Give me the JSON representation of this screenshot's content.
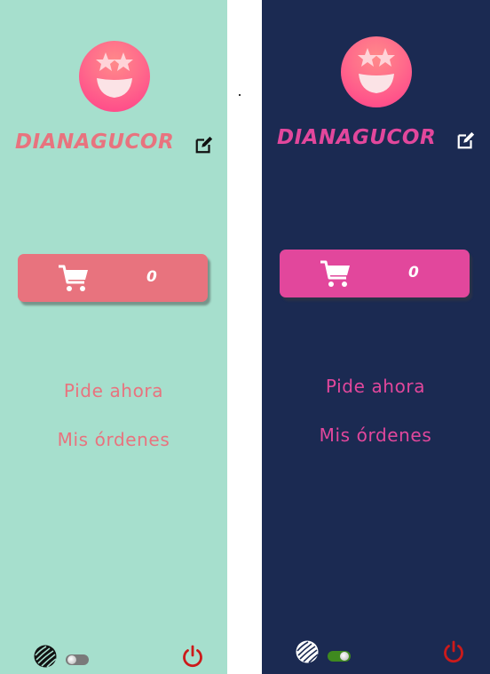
{
  "light_panel": {
    "username": "DIANAGUCOR",
    "cart_count": "0",
    "nav": {
      "order_now": "Pide ahora",
      "my_orders": "Mis órdenes"
    },
    "theme_toggle": {
      "state": "off"
    },
    "icons": {
      "avatar": "star-struck-face-icon",
      "edit": "edit-icon",
      "cart": "cart-icon",
      "theme": "theme-pattern-icon",
      "power": "power-icon"
    },
    "colors": {
      "background": "#a6dfcd",
      "accent": "#e8737e",
      "link": "#e8737e",
      "power": "#cc1a1a"
    }
  },
  "dark_panel": {
    "username": "DIANAGUCOR",
    "cart_count": "0",
    "nav": {
      "order_now": "Pide ahora",
      "my_orders": "Mis órdenes"
    },
    "theme_toggle": {
      "state": "on"
    },
    "icons": {
      "avatar": "star-struck-face-icon",
      "edit": "edit-icon",
      "cart": "cart-icon",
      "theme": "theme-pattern-icon",
      "power": "power-icon"
    },
    "colors": {
      "background": "#1b2a52",
      "accent": "#e2479c",
      "link": "#e2479c",
      "power": "#cc1a1a"
    }
  }
}
